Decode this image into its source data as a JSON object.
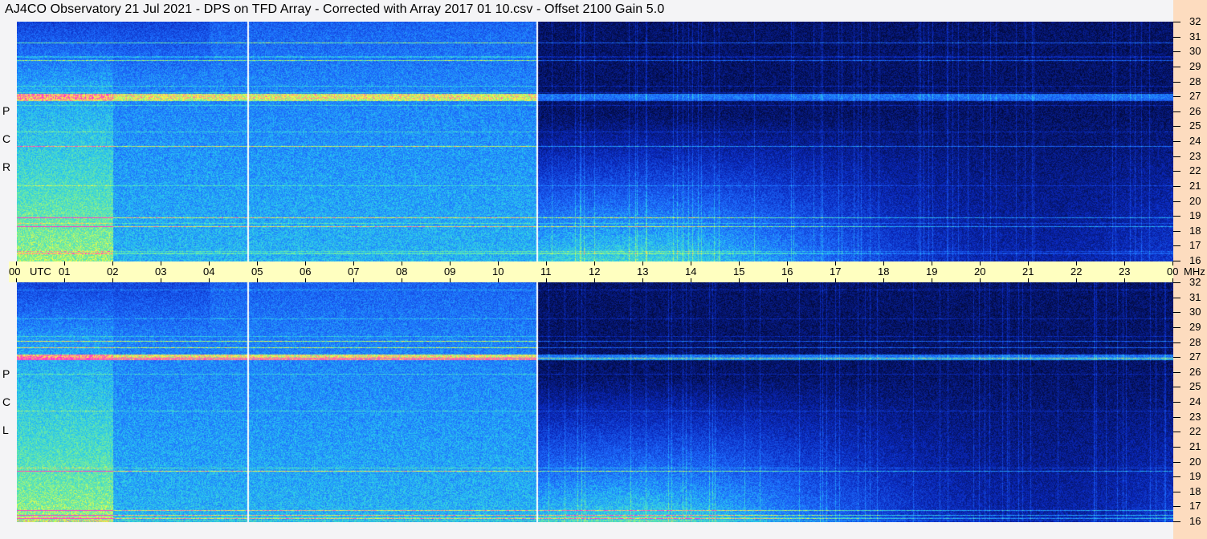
{
  "title": "AJ4CO Observatory  21 Jul 2021  -  DPS on TFD Array  -  Corrected with Array 2017 01 10.csv  -  Offset 2100  Gain 5.0",
  "chart_data": {
    "type": "heatmap",
    "title": "AJ4CO Observatory  21 Jul 2021  -  DPS on TFD Array  -  Corrected with Array 2017 01 10.csv  -  Offset 2100  Gain 5.0",
    "xlabel": "UTC",
    "ylabel": "MHz",
    "x_ticks": [
      "00",
      "01",
      "02",
      "03",
      "04",
      "05",
      "06",
      "07",
      "08",
      "09",
      "10",
      "11",
      "12",
      "13",
      "14",
      "15",
      "16",
      "17",
      "18",
      "19",
      "20",
      "21",
      "22",
      "23",
      "00"
    ],
    "y_ticks": [
      "32",
      "31",
      "30",
      "29",
      "28",
      "27",
      "26",
      "25",
      "24",
      "23",
      "22",
      "21",
      "20",
      "19",
      "18",
      "17",
      "16"
    ],
    "xlim_hours": [
      0,
      24
    ],
    "ylim_mhz": [
      16,
      32
    ],
    "panels": [
      {
        "name": "RCP",
        "label": [
          "R",
          "C",
          "P"
        ]
      },
      {
        "name": "LCP",
        "label": [
          "L",
          "C",
          "P"
        ]
      }
    ],
    "markers_utc_hours": [
      4.78,
      10.78
    ],
    "colors": {
      "low": "#000010",
      "mid": "#1a5cff",
      "high": "#30e0ff",
      "peak": "#ffff40",
      "marker": "#ffffff",
      "axis_strip": "#ffffc0",
      "freq_strip": "#fddcbf"
    }
  }
}
